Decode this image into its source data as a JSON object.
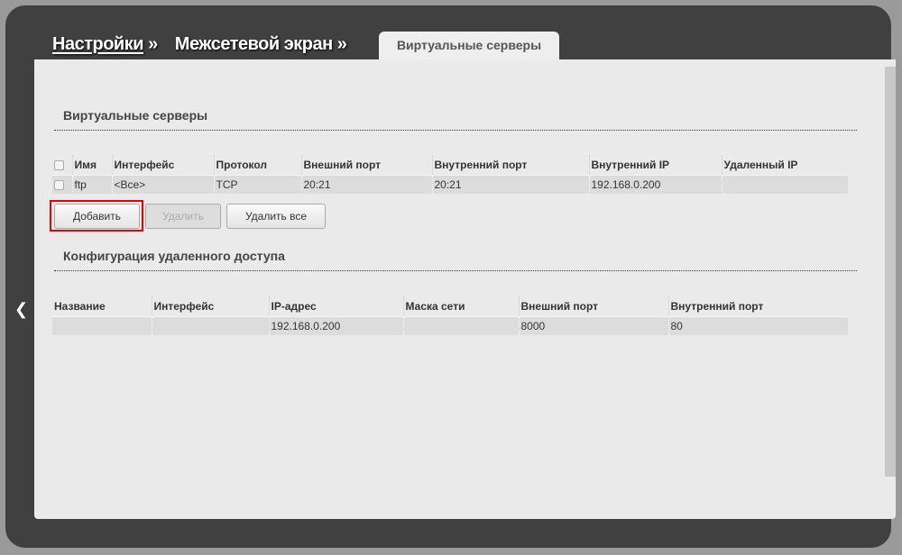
{
  "breadcrumb": {
    "settings": "Настройки",
    "sep1": "»",
    "firewall": "Межсетевой экран »"
  },
  "tab": "Виртуальные серверы",
  "virtual_servers": {
    "title": "Виртуальные серверы",
    "columns": [
      "Имя",
      "Интерфейс",
      "Протокол",
      "Внешний порт",
      "Внутренний порт",
      "Внутренний IP",
      "Удаленный IP"
    ],
    "rows": [
      [
        "ftp",
        "<Все>",
        "TCP",
        "20:21",
        "20:21",
        "192.168.0.200",
        ""
      ]
    ],
    "buttons": {
      "add": "Добавить",
      "delete": "Удалить",
      "delete_all": "Удалить все"
    }
  },
  "remote_access": {
    "title": "Конфигурация удаленного доступа",
    "columns": [
      "Название",
      "Интерфейс",
      "IP-адрес",
      "Маска сети",
      "Внешний порт",
      "Внутренний порт"
    ],
    "rows": [
      [
        "",
        "",
        "192.168.0.200",
        "",
        "8000",
        "80"
      ]
    ]
  }
}
